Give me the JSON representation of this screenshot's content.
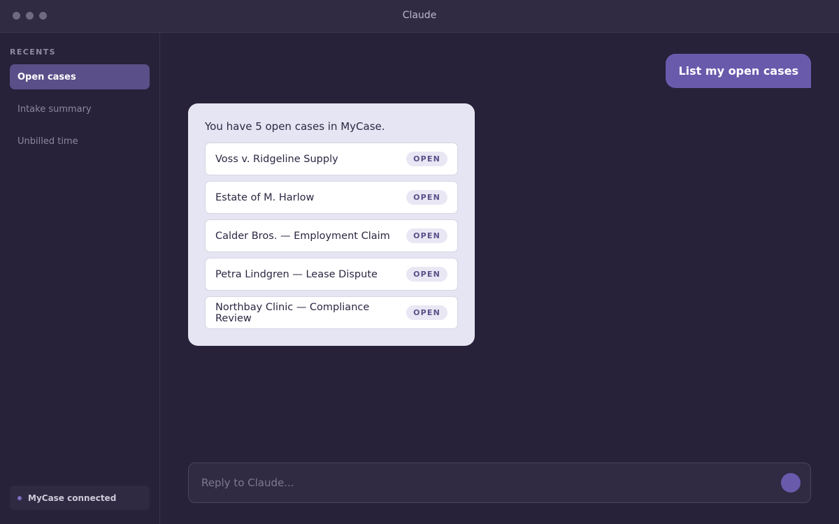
{
  "window": {
    "title": "Claude"
  },
  "sidebar": {
    "section_label": "RECENTS",
    "items": [
      {
        "label": "Open cases",
        "active": true
      },
      {
        "label": "Intake summary",
        "active": false
      },
      {
        "label": "Unbilled time",
        "active": false
      }
    ],
    "connector": {
      "label": "MyCase connected",
      "status": "connected"
    }
  },
  "chat": {
    "user_message": "List my open cases",
    "assistant": {
      "intro": "You have 5 open cases in MyCase.",
      "cases": [
        {
          "name": "Voss v. Ridgeline Supply",
          "status": "OPEN"
        },
        {
          "name": "Estate of M. Harlow",
          "status": "OPEN"
        },
        {
          "name": "Calder Bros. — Employment Claim",
          "status": "OPEN"
        },
        {
          "name": "Petra Lindgren — Lease Dispute",
          "status": "OPEN"
        },
        {
          "name": "Northbay Clinic — Compliance Review",
          "status": "OPEN"
        }
      ]
    }
  },
  "composer": {
    "placeholder": "Reply to Claude...",
    "value": ""
  },
  "colors": {
    "background": "#272139",
    "accent": "#6a5aac",
    "sidebar_active": "#5a4f88",
    "card": "#e6e5f3"
  }
}
